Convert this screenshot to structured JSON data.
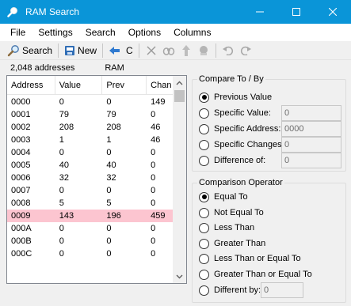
{
  "window": {
    "title": "RAM Search",
    "icon": "magnifier-icon",
    "controls": [
      "minimize",
      "maximize",
      "close"
    ]
  },
  "menu": [
    "File",
    "Settings",
    "Search",
    "Options",
    "Columns"
  ],
  "toolbar": {
    "search_label": "Search",
    "new_label": "New",
    "c_label": "C",
    "icons": [
      "search-icon",
      "new-icon",
      "back-arrow-icon",
      "cut-icon",
      "watch-icon",
      "poke-icon",
      "freeze-icon",
      "undo-icon",
      "redo-icon"
    ]
  },
  "status": {
    "address_count": "2,048 addresses",
    "memory_label": "RAM"
  },
  "list": {
    "headers": [
      "Address",
      "Value",
      "Prev",
      "Chan"
    ],
    "rows": [
      [
        "0000",
        "0",
        "0",
        "149"
      ],
      [
        "0001",
        "79",
        "79",
        "0"
      ],
      [
        "0002",
        "208",
        "208",
        "46"
      ],
      [
        "0003",
        "1",
        "1",
        "46"
      ],
      [
        "0004",
        "0",
        "0",
        "0"
      ],
      [
        "0005",
        "40",
        "40",
        "0"
      ],
      [
        "0006",
        "32",
        "32",
        "0"
      ],
      [
        "0007",
        "0",
        "0",
        "0"
      ],
      [
        "0008",
        "5",
        "5",
        "0"
      ],
      [
        "0009",
        "143",
        "196",
        "459"
      ],
      [
        "000A",
        "0",
        "0",
        "0"
      ],
      [
        "000B",
        "0",
        "0",
        "0"
      ],
      [
        "000C",
        "0",
        "0",
        "0"
      ]
    ],
    "highlight_row": "0009",
    "highlight_color": "#fcc5d0"
  },
  "compare_to": {
    "title": "Compare To / By",
    "options": [
      {
        "label": "Previous Value",
        "checked": true
      },
      {
        "label": "Specific Value:",
        "checked": false,
        "input": "0"
      },
      {
        "label": "Specific Address:",
        "checked": false,
        "input": "0000"
      },
      {
        "label": "Specific Changes:",
        "checked": false,
        "input": "0"
      },
      {
        "label": "Difference of:",
        "checked": false,
        "input": "0"
      }
    ]
  },
  "comparison_operator": {
    "title": "Comparison Operator",
    "options": [
      {
        "label": "Equal To",
        "checked": true
      },
      {
        "label": "Not Equal To",
        "checked": false
      },
      {
        "label": "Less Than",
        "checked": false
      },
      {
        "label": "Greater Than",
        "checked": false
      },
      {
        "label": "Less Than or Equal To",
        "checked": false
      },
      {
        "label": "Greater Than or Equal To",
        "checked": false
      },
      {
        "label": "Different by:",
        "checked": false,
        "input": "0"
      }
    ]
  },
  "colors": {
    "titlebar": "#0a95d8",
    "background": "#f0f0f0"
  }
}
